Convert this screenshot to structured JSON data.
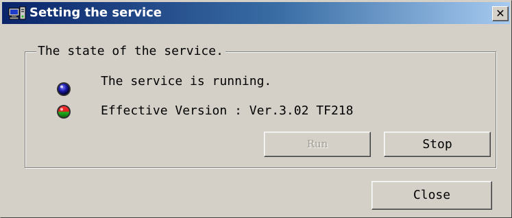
{
  "window": {
    "title": "Setting the service",
    "close_glyph": "✕"
  },
  "group": {
    "label": "The state of the service."
  },
  "status": {
    "running_text": "The service is running.",
    "version_text": "Effective Version : Ver.3.02 TF218",
    "running_indicator_color": "#1a1aa6",
    "version_indicator_colors": [
      "#e02020",
      "#20b020"
    ]
  },
  "buttons": {
    "run": {
      "label": "Run",
      "enabled": false
    },
    "stop": {
      "label": "Stop",
      "enabled": true
    },
    "close": {
      "label": "Close",
      "enabled": true
    }
  },
  "icons": {
    "app": "computer-service-icon",
    "running_indicator": "blue-led-icon",
    "version_indicator": "red-green-led-icon",
    "close": "close-icon"
  },
  "colors": {
    "titlebar_start": "#0a246a",
    "titlebar_end": "#a6caf0",
    "dialog_face": "#d4d0c8"
  }
}
